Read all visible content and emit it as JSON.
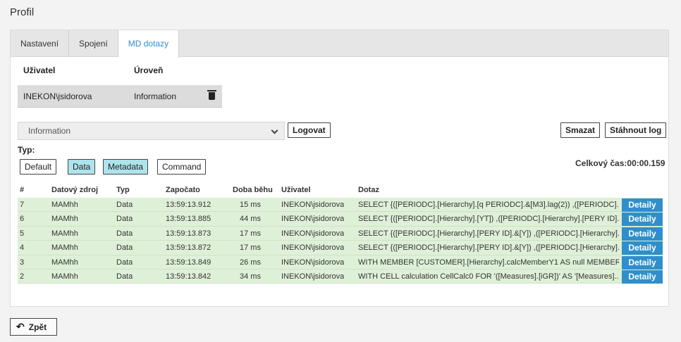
{
  "page": {
    "title": "Profil"
  },
  "tabs": [
    {
      "label": "Nastavení"
    },
    {
      "label": "Spojení"
    },
    {
      "label": "MD dotazy"
    }
  ],
  "users_table": {
    "headers": [
      "Uživatel",
      "Úroveň"
    ],
    "row": {
      "user": "INEKON\\jsidorova",
      "level": "Information"
    }
  },
  "controls": {
    "level_select": "Information",
    "log_button": "Logovat",
    "delete_button": "Smazat",
    "download_button": "Stáhnout log",
    "type_label": "Typ:",
    "type_buttons": [
      "Default",
      "Data",
      "Metadata",
      "Command"
    ],
    "total_time_label": "Celkový čas:",
    "total_time_value": "00:00.159"
  },
  "grid": {
    "headers": [
      "#",
      "Datový zdroj",
      "Typ",
      "Započato",
      "Doba běhu",
      "Uživatel",
      "Dotaz"
    ],
    "detail_label": "Detaily",
    "rows": [
      {
        "n": "7",
        "source": "MAMhh",
        "type": "Data",
        "start": "13:59:13.912",
        "duration": "15 ms",
        "user": "INEKON\\jsidorova",
        "query": "SELECT {([PERIODC].[Hierarchy].[q PERIODC].&[M3].lag(2)) ,([PERIODC].[..."
      },
      {
        "n": "6",
        "source": "MAMhh",
        "type": "Data",
        "start": "13:59:13.885",
        "duration": "44 ms",
        "user": "INEKON\\jsidorova",
        "query": "SELECT {([PERIODC].[Hierarchy].[YT]) ,([PERIODC].[Hierarchy].[PERY ID]...."
      },
      {
        "n": "5",
        "source": "MAMhh",
        "type": "Data",
        "start": "13:59:13.873",
        "duration": "17 ms",
        "user": "INEKON\\jsidorova",
        "query": "SELECT {([PERIODC].[Hierarchy].[PERY ID].&[Y]) ,([PERIODC].[Hierarchy].[..."
      },
      {
        "n": "4",
        "source": "MAMhh",
        "type": "Data",
        "start": "13:59:13.872",
        "duration": "17 ms",
        "user": "INEKON\\jsidorova",
        "query": "SELECT {([PERIODC].[Hierarchy].[PERY ID].&[Y]) ,([PERIODC].[Hierarchy].[..."
      },
      {
        "n": "3",
        "source": "MAMhh",
        "type": "Data",
        "start": "13:59:13.849",
        "duration": "26 ms",
        "user": "INEKON\\jsidorova",
        "query": "WITH MEMBER [CUSTOMER].[Hierarchy].calcMemberY1 AS null MEMBER..."
      },
      {
        "n": "2",
        "source": "MAMhh",
        "type": "Data",
        "start": "13:59:13.842",
        "duration": "34 ms",
        "user": "INEKON\\jsidorova",
        "query": "WITH CELL calculation CellCalc0 FOR '([Measures].[iGR])' AS '[Measures]...."
      }
    ]
  },
  "footer": {
    "back_label": "Zpět"
  }
}
